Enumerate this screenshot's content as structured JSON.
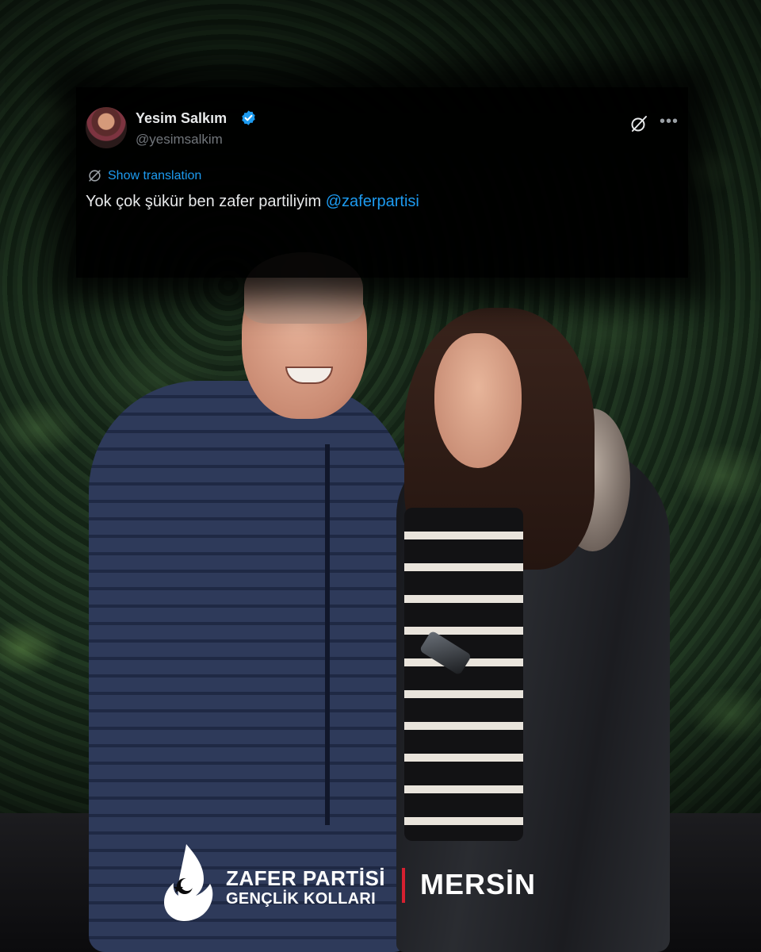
{
  "tweet": {
    "display_name": "Yesim Salkım",
    "handle": "@yesimsalkim",
    "translate_label": "Show translation",
    "text_plain": "Yok çok şükür ben zafer partiliyim ",
    "mention": "@zaferpartisi",
    "verified_color": "#1d9bf0",
    "icons": [
      "grok-icon",
      "more-icon",
      "translate-icon",
      "verified-badge-icon"
    ]
  },
  "branding": {
    "party_name": "ZAFER PARTİSİ",
    "subtitle": "GENÇLİK KOLLARI",
    "city": "MERSİN",
    "accent": "#d62030"
  }
}
